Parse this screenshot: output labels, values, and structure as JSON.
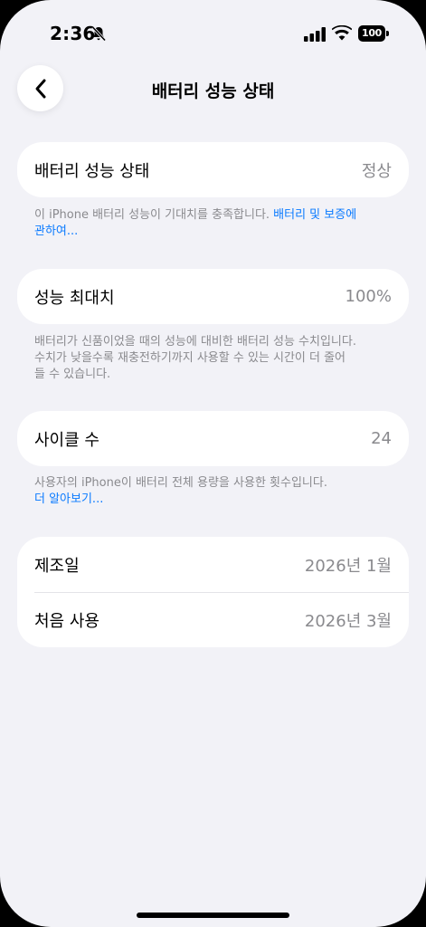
{
  "status_bar": {
    "time": "2:36",
    "battery_level": "100"
  },
  "nav": {
    "title": "배터리 성능 상태"
  },
  "health_card": {
    "label": "배터리 성능 상태",
    "value": "정상"
  },
  "health_footnote": {
    "text": "이 iPhone 배터리 성능이 기대치를 충족합니다. ",
    "link_line1": "배터리 및 보증에",
    "link_line2": "관하여..."
  },
  "capacity_card": {
    "label": "성능 최대치",
    "value": "100%"
  },
  "capacity_footnote": {
    "line1": "배터리가 신품이었을 때의 성능에 대비한 배터리 성능 수치입니다.",
    "line2": "수치가 낮을수록 재충전하기까지 사용할 수 있는 시간이 더 줄어",
    "line3": "들 수 있습니다."
  },
  "cycle_card": {
    "label": "사이클 수",
    "value": "24"
  },
  "cycle_footnote": {
    "text": "사용자의 iPhone이 배터리 전체 용량을 사용한 횟수입니다.",
    "link": "더 알아보기..."
  },
  "dates_card": {
    "manufacture_label": "제조일",
    "manufacture_value": "2026년 1월",
    "first_use_label": "처음 사용",
    "first_use_value": "2026년 3월"
  },
  "colors": {
    "background": "#f2f2f7",
    "card": "#ffffff",
    "link": "#0a7aff",
    "secondary_text": "#8a8a8e"
  }
}
